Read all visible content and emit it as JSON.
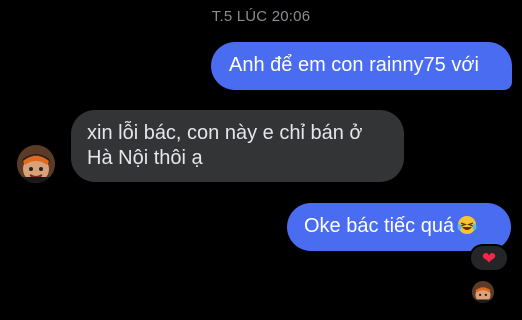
{
  "conversation": {
    "timestamp": "T.5 LÚC 20:06",
    "messages": [
      {
        "direction": "outgoing",
        "text": "Anh để em con rainny75 với"
      },
      {
        "direction": "incoming",
        "line1": "xin lỗi bác, con này e chỉ bán ở",
        "line2": "Hà Nội thôi ạ"
      },
      {
        "direction": "outgoing",
        "text": "Oke bác tiếc quá",
        "emoji": "laughing-tears-emoji"
      }
    ],
    "reaction": {
      "emoji": "❤",
      "icon": "heart-icon"
    },
    "colors": {
      "outgoing_bubble": "#4a6cf0",
      "incoming_bubble": "#333436",
      "background": "#000000",
      "timestamp": "#8a8d91",
      "heart": "#f0284a"
    }
  }
}
